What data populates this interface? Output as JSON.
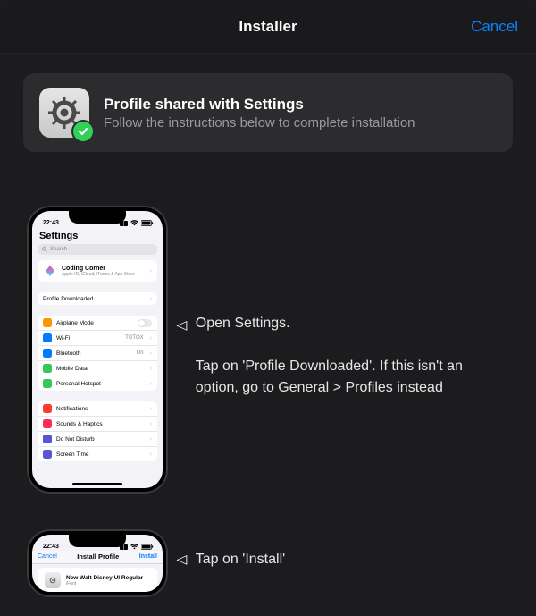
{
  "header": {
    "title": "Installer",
    "cancel": "Cancel"
  },
  "banner": {
    "title": "Profile shared with Settings",
    "subtitle": "Follow the instructions below to complete installation"
  },
  "steps": {
    "one": "Open Settings.\n\nTap on 'Profile Downloaded'. If this isn't an option, go to General > Profiles instead",
    "two": "Tap on 'Install'"
  },
  "phone1": {
    "time": "22:43",
    "title": "Settings",
    "search_placeholder": "Search",
    "account": {
      "name": "Coding Corner",
      "detail": "Apple ID, iCloud, iTunes & App Store"
    },
    "profile_row": "Profile Downloaded",
    "rows_a": [
      {
        "icon": "airplane",
        "color": "#ff9500",
        "label": "Airplane Mode",
        "trailing": "toggle"
      },
      {
        "icon": "wifi",
        "color": "#007aff",
        "label": "Wi-Fi",
        "trailing_text": "TOTOX"
      },
      {
        "icon": "bluetooth",
        "color": "#007aff",
        "label": "Bluetooth",
        "trailing_text": "On"
      },
      {
        "icon": "antenna",
        "color": "#34c759",
        "label": "Mobile Data"
      },
      {
        "icon": "hotspot",
        "color": "#34c759",
        "label": "Personal Hotspot"
      }
    ],
    "rows_b": [
      {
        "icon": "bell",
        "color": "#ff3b30",
        "label": "Notifications"
      },
      {
        "icon": "speaker",
        "color": "#ff2d55",
        "label": "Sounds & Haptics"
      },
      {
        "icon": "moon",
        "color": "#5856d6",
        "label": "Do Not Disturb"
      },
      {
        "icon": "hourglass",
        "color": "#5856d6",
        "label": "Screen Time"
      }
    ]
  },
  "phone2": {
    "time": "22:43",
    "nav": {
      "left": "Cancel",
      "center": "Install Profile",
      "right": "Install"
    },
    "profile": {
      "name": "New Walt Disney UI Regular",
      "signer": "iFont"
    }
  }
}
